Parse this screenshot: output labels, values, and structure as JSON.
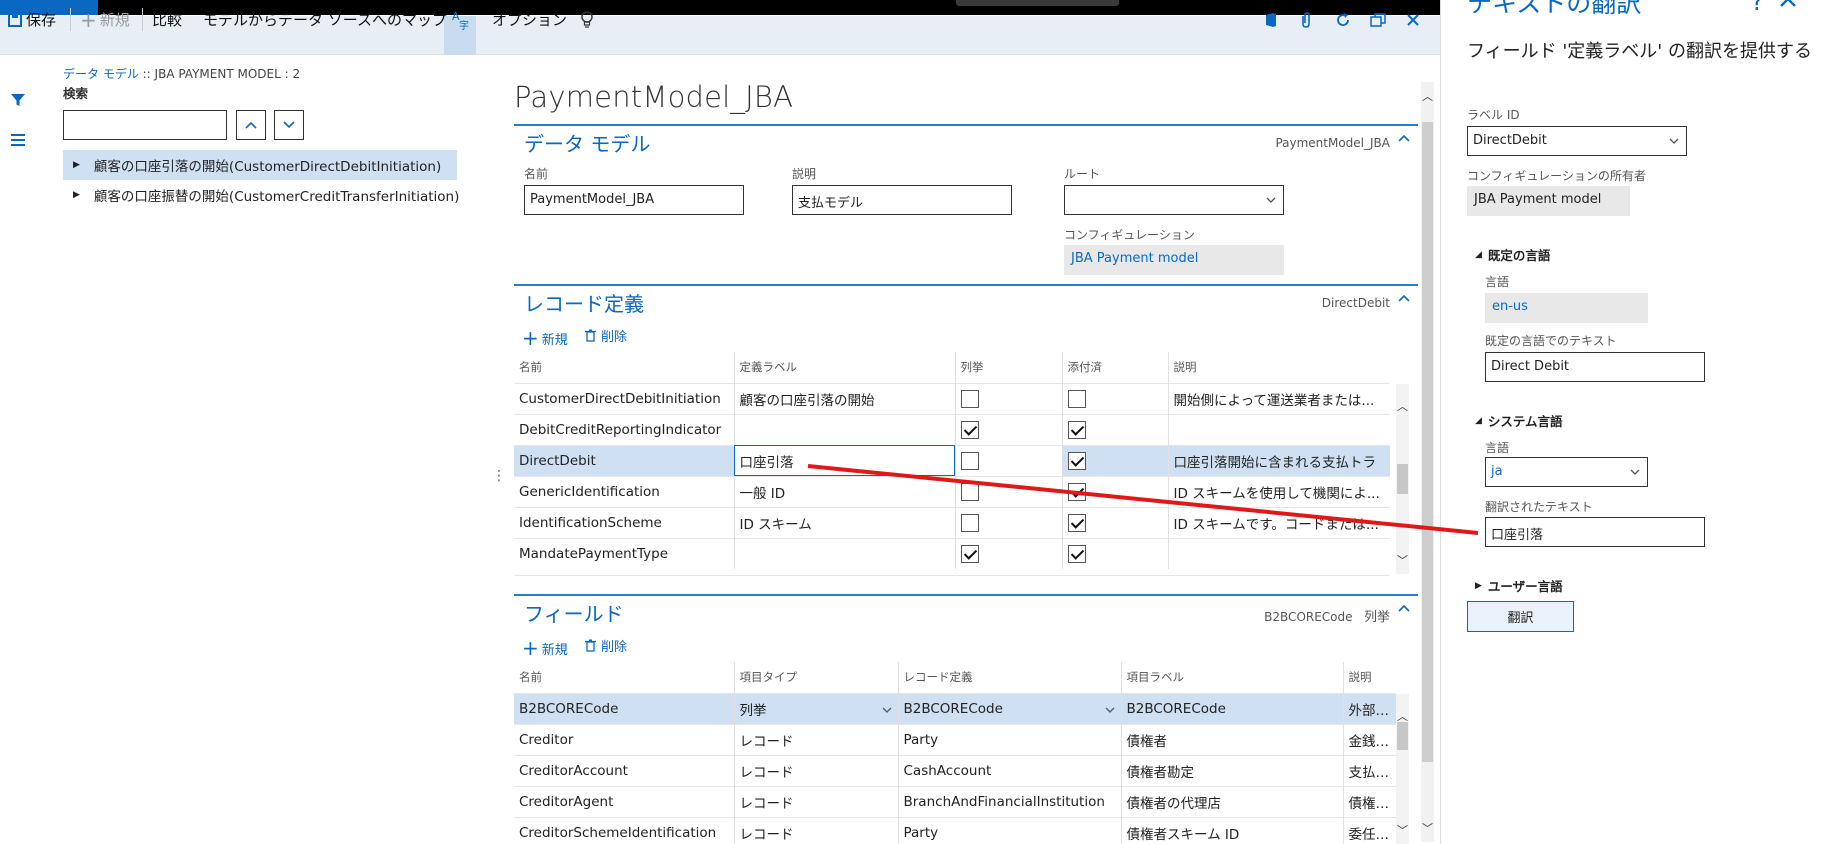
{
  "toolbar": {
    "save": "保存",
    "new": "新規",
    "compare": "比較",
    "map": "モデルからデータ ソースへのマップ",
    "options": "オプション"
  },
  "left": {
    "breadcrumb_link": "データ モデル",
    "breadcrumb_rest": " :: JBA PAYMENT MODEL : 2",
    "search_label": "検索",
    "tree": [
      "顧客の口座引落の開始(CustomerDirectDebitInitiation)",
      "顧客の口座振替の開始(CustomerCreditTransferInitiation)"
    ]
  },
  "page_title": "PaymentModel_JBA",
  "datamodel": {
    "title": "データ モデル",
    "right": "PaymentModel_JBA",
    "name_label": "名前",
    "name_value": "PaymentModel_JBA",
    "desc_label": "説明",
    "desc_value": "支払モデル",
    "root_label": "ルート",
    "root_value": "",
    "config_label": "コンフィギュレーション",
    "config_value": "JBA Payment model"
  },
  "records": {
    "title": "レコード定義",
    "right": "DirectDebit",
    "new": "新規",
    "delete": "削除",
    "columns": [
      "名前",
      "定義ラベル",
      "列挙",
      "添付済",
      "説明"
    ],
    "rows": [
      {
        "name": "CustomerDirectDebitInitiation",
        "label": "顧客の口座引落の開始",
        "enum": false,
        "attached": false,
        "desc": "開始側によって運送業者または..."
      },
      {
        "name": "DebitCreditReportingIndicator",
        "label": "",
        "enum": true,
        "attached": true,
        "desc": ""
      },
      {
        "name": "DirectDebit",
        "label": "口座引落",
        "enum": false,
        "attached": true,
        "desc": "口座引落開始に含まれる支払トラ"
      },
      {
        "name": "GenericIdentification",
        "label": "一般 ID",
        "enum": false,
        "attached": true,
        "desc": "ID スキームを使用して機関によ..."
      },
      {
        "name": "IdentificationScheme",
        "label": "ID スキーム",
        "enum": false,
        "attached": true,
        "desc": "ID スキームです。コードまたは..."
      },
      {
        "name": "MandatePaymentType",
        "label": "",
        "enum": true,
        "attached": true,
        "desc": ""
      }
    ]
  },
  "fields": {
    "title": "フィールド",
    "right1": "B2BCORECode",
    "right2": "列挙",
    "new": "新規",
    "delete": "削除",
    "columns": [
      "名前",
      "項目タイプ",
      "レコード定義",
      "項目ラベル",
      "説明"
    ],
    "rows": [
      {
        "name": "B2BCORECode",
        "type": "列挙",
        "record": "B2BCORECode",
        "label": "B2BCORECode",
        "desc": "外部のD"
      },
      {
        "name": "Creditor",
        "type": "レコード",
        "record": "Party",
        "label": "債権者",
        "desc": "金銭が支"
      },
      {
        "name": "CreditorAccount",
        "type": "レコード",
        "record": "CashAccount",
        "label": "債権者勘定",
        "desc": "支払トラ"
      },
      {
        "name": "CreditorAgent",
        "type": "レコード",
        "record": "BranchAndFinancialInstitution",
        "label": "債権者の代理店",
        "desc": "債権者の"
      },
      {
        "name": "CreditorSchemeIdentification",
        "type": "レコード",
        "record": "Party",
        "label": "債権者スキーム ID",
        "desc": "委任状に"
      }
    ]
  },
  "right": {
    "title": "テキストの翻訳",
    "heading": "フィールド '定義ラベル' の翻訳を提供する",
    "label_id_label": "ラベル ID",
    "label_id_value": "DirectDebit",
    "owner_label": "コンフィギュレーションの所有者",
    "owner_value": "JBA Payment model",
    "default_lang_header": "既定の言語",
    "lang_label": "言語",
    "default_lang_value": "en-us",
    "default_text_label": "既定の言語でのテキスト",
    "default_text_value": "Direct Debit",
    "system_lang_header": "システム言語",
    "system_lang_label": "言語",
    "system_lang_value": "ja",
    "translated_label": "翻訳されたテキスト",
    "translated_value": "口座引落",
    "user_lang_header": "ユーザー言語",
    "translate_button": "翻訳"
  },
  "colors": {
    "accent": "#0a67c2",
    "selection": "#cfe0f2",
    "toolbar": "#e7eef6",
    "arrow": "#e01818"
  }
}
